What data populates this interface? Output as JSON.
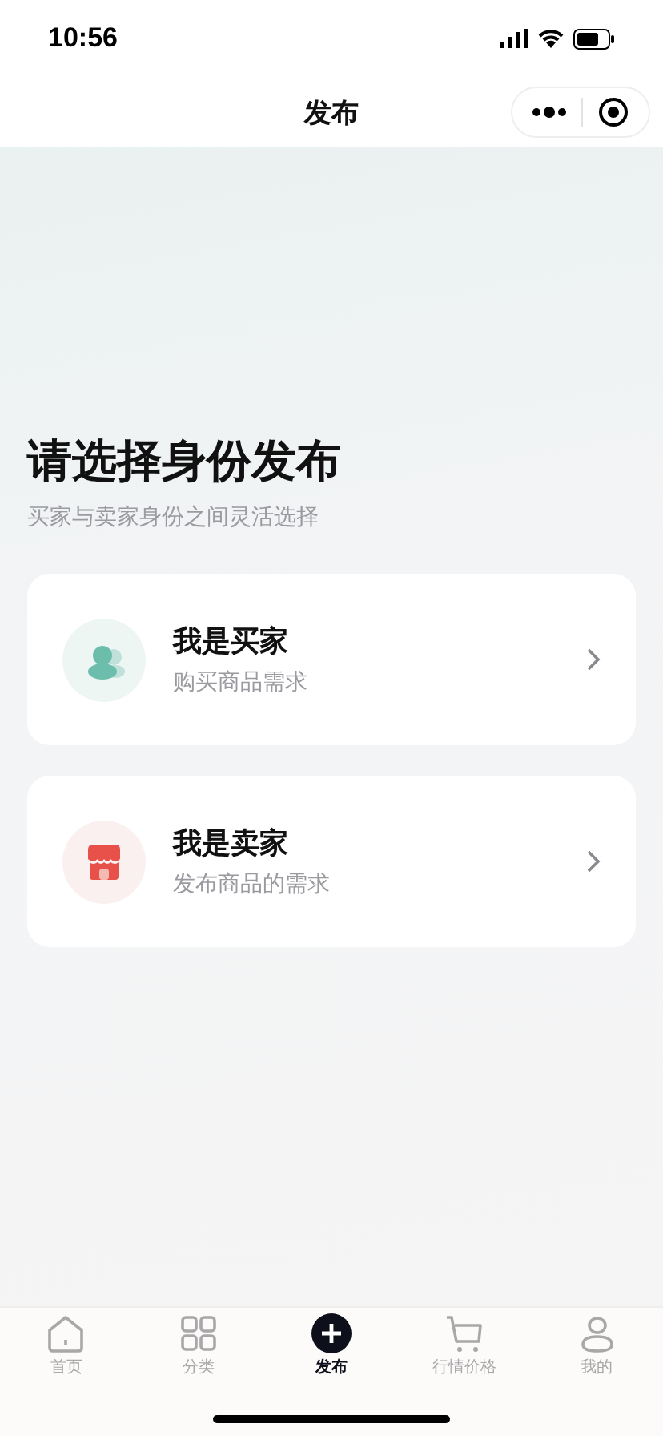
{
  "status_bar": {
    "time": "10:56"
  },
  "nav": {
    "title": "发布"
  },
  "heading": "请选择身份发布",
  "subtitle": "买家与卖家身份之间灵活选择",
  "options": [
    {
      "kind": "buyer",
      "title": "我是买家",
      "description": "购买商品需求"
    },
    {
      "kind": "seller",
      "title": "我是卖家",
      "description": "发布商品的需求"
    }
  ],
  "tab_bar": [
    {
      "kind": "home",
      "label": "首页",
      "selected": false
    },
    {
      "kind": "grid",
      "label": "分类",
      "selected": false
    },
    {
      "kind": "plus",
      "label": "发布",
      "selected": true
    },
    {
      "kind": "cart",
      "label": "行情价格",
      "selected": false
    },
    {
      "kind": "person",
      "label": "我的",
      "selected": false
    }
  ]
}
